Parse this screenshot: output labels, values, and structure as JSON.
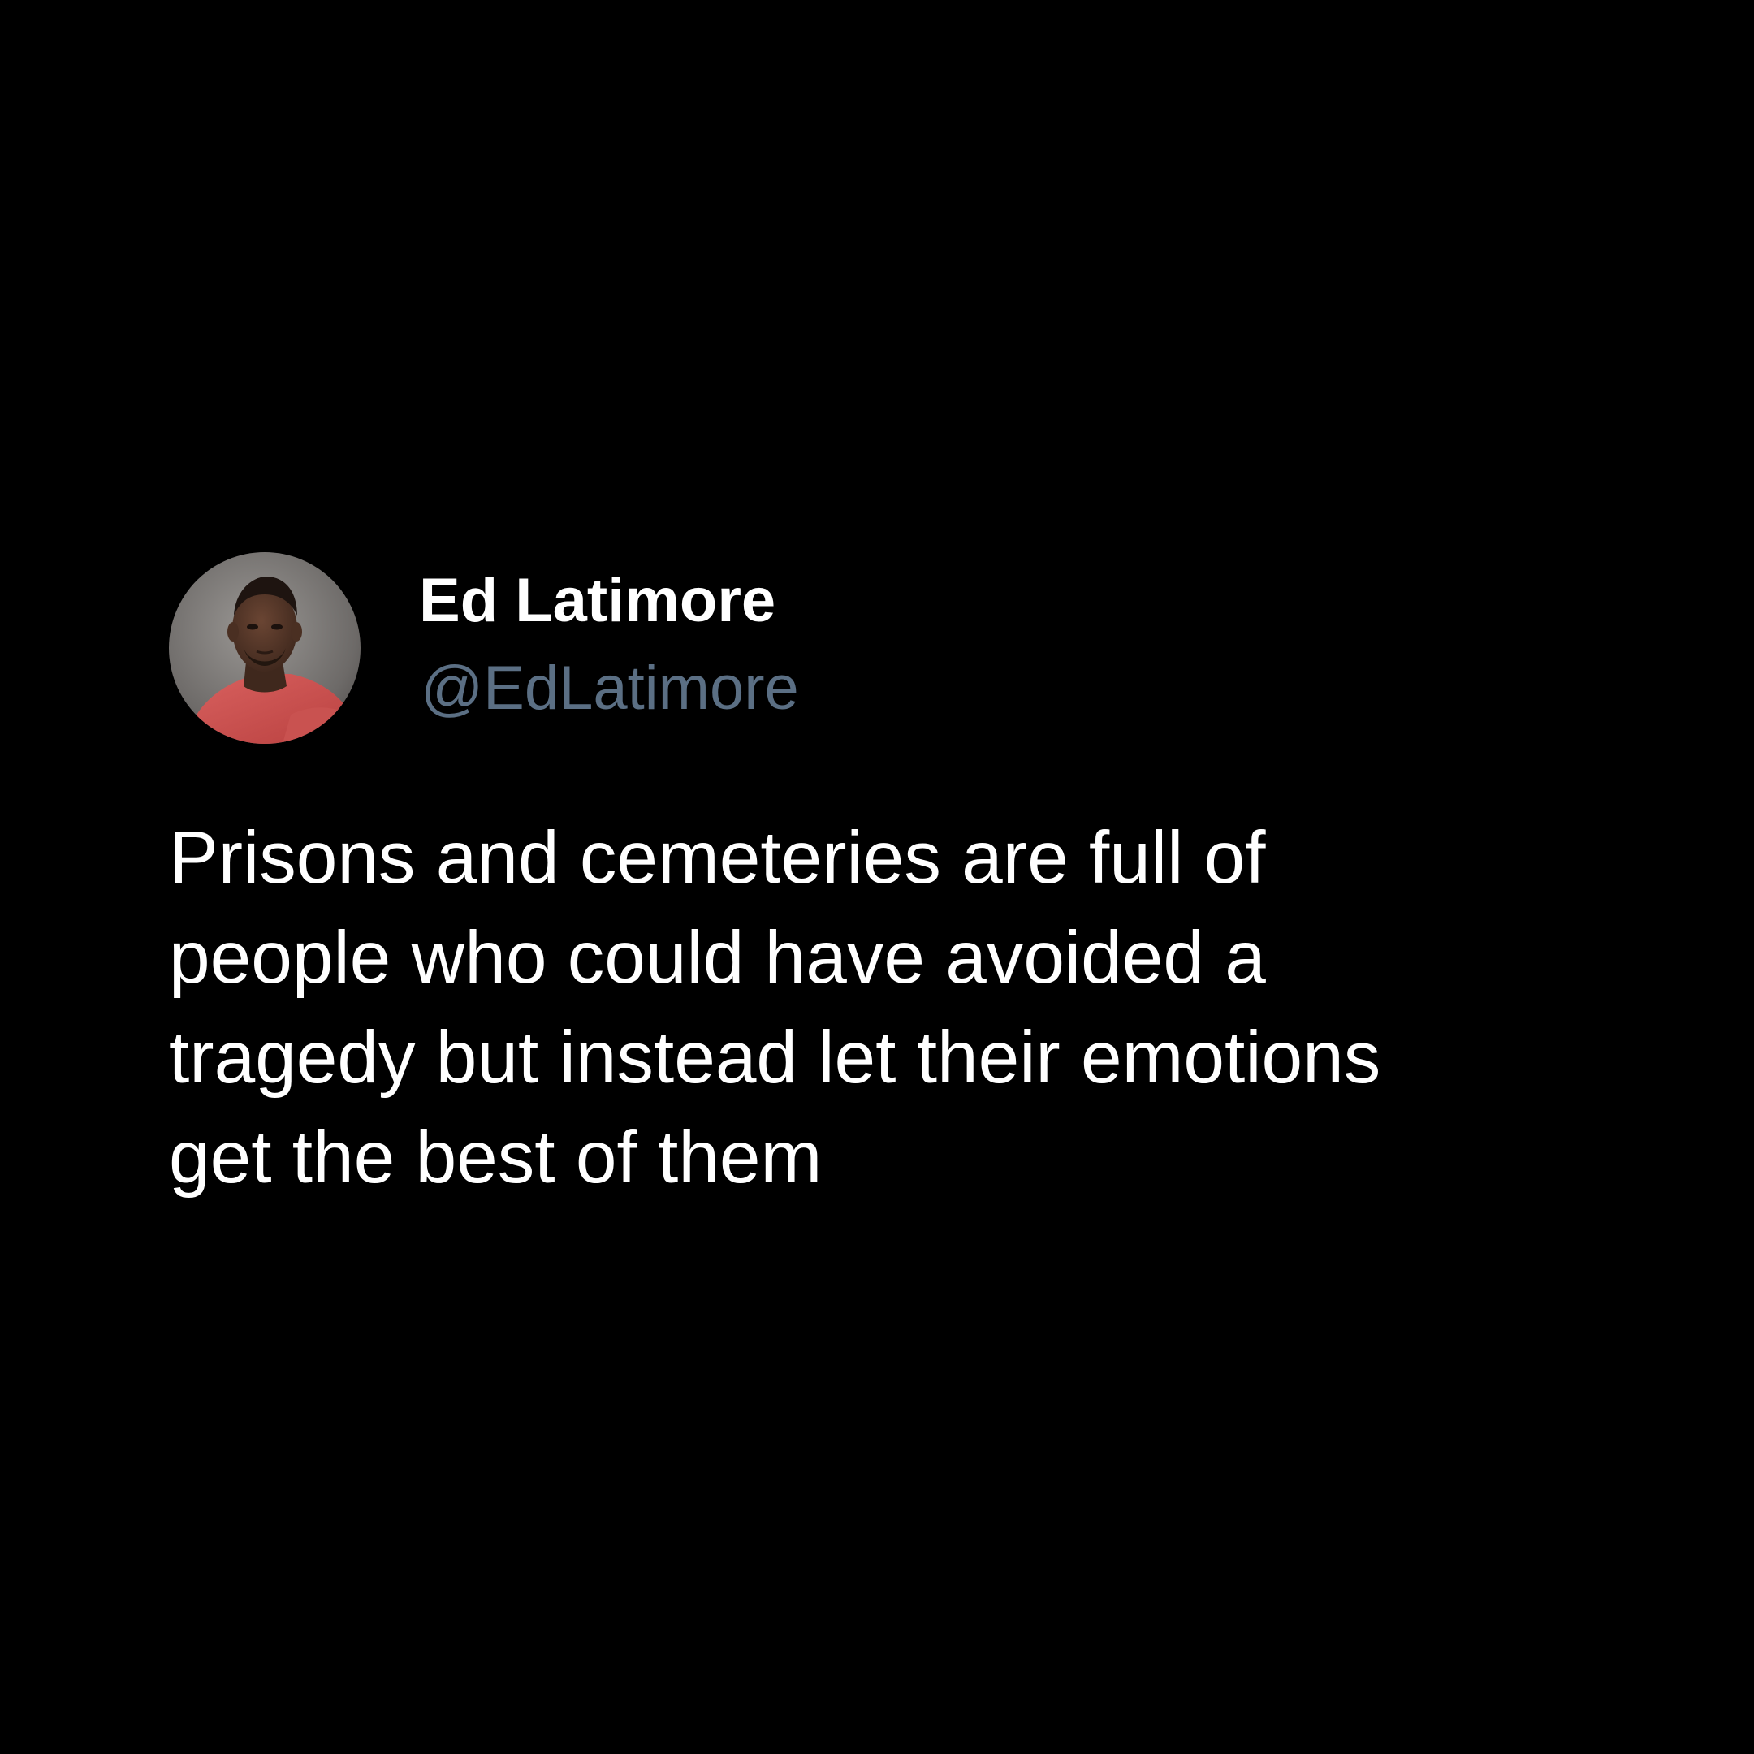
{
  "tweet": {
    "author": {
      "display_name": "Ed Latimore",
      "handle": "@EdLatimore",
      "avatar_icon": "profile-photo"
    },
    "text": "Prisons and cemeteries are full of\npeople who could have avoided a\ntragedy but instead let their emotions\nget the best of them"
  },
  "colors": {
    "background": "#000000",
    "name": "#ffffff",
    "handle": "#5b6f84",
    "body_text": "#ffffff"
  }
}
